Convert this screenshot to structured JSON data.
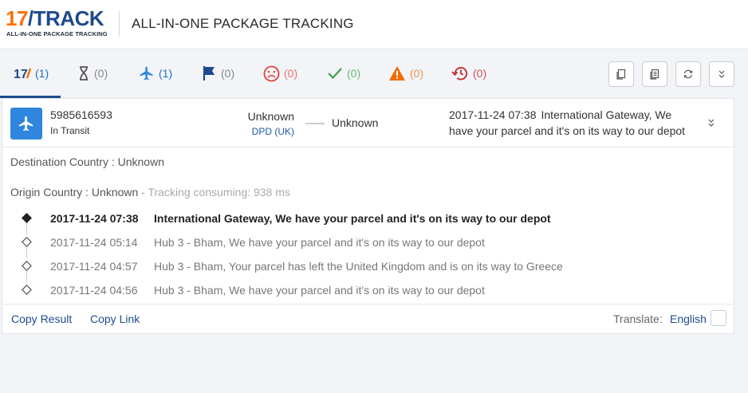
{
  "header": {
    "logo_main_num": "17",
    "logo_main_text": "TRACK",
    "logo_sub": "ALL-IN-ONE PACKAGE TRACKING",
    "title": "ALL-IN-ONE PACKAGE TRACKING"
  },
  "tabs": [
    {
      "icon": "17track-logo-icon",
      "count": "(1)",
      "color": "#1e4a8c"
    },
    {
      "icon": "hourglass-icon",
      "count": "(0)",
      "color": "#555555"
    },
    {
      "icon": "airplane-icon",
      "count": "(1)",
      "color": "#2e86de"
    },
    {
      "icon": "flag-icon",
      "count": "(0)",
      "color": "#1e4a8c"
    },
    {
      "icon": "sad-face-icon",
      "count": "(0)",
      "color": "#e53935"
    },
    {
      "icon": "checkmark-icon",
      "count": "(0)",
      "color": "#43a047"
    },
    {
      "icon": "warning-icon",
      "count": "(0)",
      "color": "#ef6c00"
    },
    {
      "icon": "history-icon",
      "count": "(0)",
      "color": "#c62828"
    }
  ],
  "toolbar": {
    "buttons": [
      "copy-icon",
      "copy-all-icon",
      "refresh-icon",
      "collapse-all-icon"
    ]
  },
  "shipment": {
    "tracking_number": "5985616593",
    "status": "In Transit",
    "origin": "Unknown",
    "carrier": "DPD (UK)",
    "destination": "Unknown",
    "latest_time": "2017-11-24 07:38",
    "latest_desc": "International Gateway, We have your parcel and it's on its way to our depot",
    "destination_country": "Destination Country : Unknown",
    "origin_country": "Origin Country : Unknown",
    "tracking_consuming": " - Tracking consuming: 938 ms"
  },
  "events": [
    {
      "time": "2017-11-24 07:38",
      "desc": "International Gateway, We have your parcel and it's on its way to our depot"
    },
    {
      "time": "2017-11-24 05:14",
      "desc": "Hub 3 - Bham, We have your parcel and it's on its way to our depot"
    },
    {
      "time": "2017-11-24 04:57",
      "desc": "Hub 3 - Bham, Your parcel has left the United Kingdom and is on its way to Greece"
    },
    {
      "time": "2017-11-24 04:56",
      "desc": "Hub 3 - Bham, We have your parcel and it's on its way to our depot"
    }
  ],
  "footer": {
    "copy_result": "Copy Result",
    "copy_link": "Copy Link",
    "translate_label": "Translate:",
    "translate_lang": "English"
  }
}
